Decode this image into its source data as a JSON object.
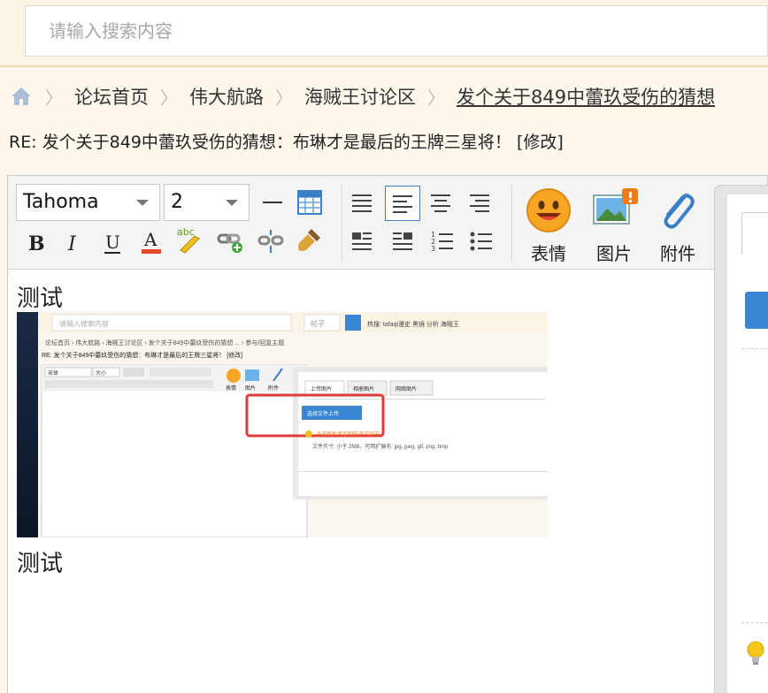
{
  "search": {
    "placeholder": "请输入搜索内容"
  },
  "breadcrumb": {
    "items": [
      "论坛首页",
      "伟大航路",
      "海贼王讨论区"
    ],
    "current": "发个关于849中蕾玖受伤的猜想"
  },
  "page_title": "RE: 发个关于849中蕾玖受伤的猜想：布琳才是最后的王牌三星将！ [修改]",
  "toolbar": {
    "font_family": "Tahoma",
    "font_size": "2",
    "emoji_label": "表情",
    "image_label": "图片",
    "attachment_label": "附件"
  },
  "content": {
    "line1": "测试",
    "line2": "测试"
  },
  "screenshot_thumb": {
    "search_placeholder": "请输入搜索内容",
    "search_scope": "帖子",
    "hot_searches": "热搜: tafaqi漫史 黑镜 分析 海贼王",
    "breadcrumb": "论坛首页 › 伟大航路 › 海贼王讨论区 › 发个关于849中蕾玖受伤的猜想 ... › 参与/回复主题",
    "title": "RE: 发个关于849中蕾玖受伤的猜想：布琳才是最后的王牌三星将！ [修改]",
    "font": "宋体",
    "size": "大小",
    "tab_upload": "上传图片",
    "tab_album": "相册图片",
    "tab_web": "网络图片",
    "upload_button": "选择文件上传",
    "notice": "点击图片添加到帖子内容中",
    "file_info": "文件尺寸: 小于 2MB，可用扩展名: jpg, jpeg, gif, png, bmp",
    "emoji": "表情",
    "image": "图片",
    "attach": "附件"
  },
  "colors": {
    "accent_blue": "#3a86d4",
    "highlight_red": "#e03a3a",
    "top_border": "#f3dcb0"
  },
  "icons": [
    "home-icon",
    "hr-icon",
    "table-icon",
    "bold-icon",
    "italic-icon",
    "underline-icon",
    "font-color-icon",
    "spellcheck-icon",
    "link-icon",
    "unlink-icon",
    "format-brush-icon",
    "align-justify-icon",
    "align-left-icon",
    "align-center-icon",
    "align-right-icon",
    "float-left-icon",
    "float-right-icon",
    "ordered-list-icon",
    "unordered-list-icon",
    "emoji-icon",
    "image-icon",
    "attachment-icon",
    "lightbulb-icon"
  ]
}
